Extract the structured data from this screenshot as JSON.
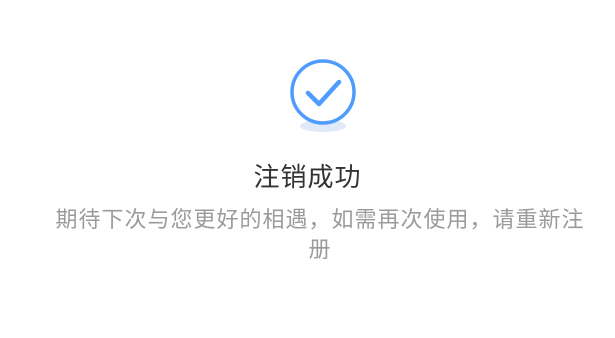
{
  "status": {
    "title": "注销成功",
    "message": "期待下次与您更好的相遇，如需再次使用，请重新注册",
    "icon": "check-circle-icon",
    "icon_color": "#4f9cff",
    "icon_shadow_color": "#dfe9f8"
  }
}
